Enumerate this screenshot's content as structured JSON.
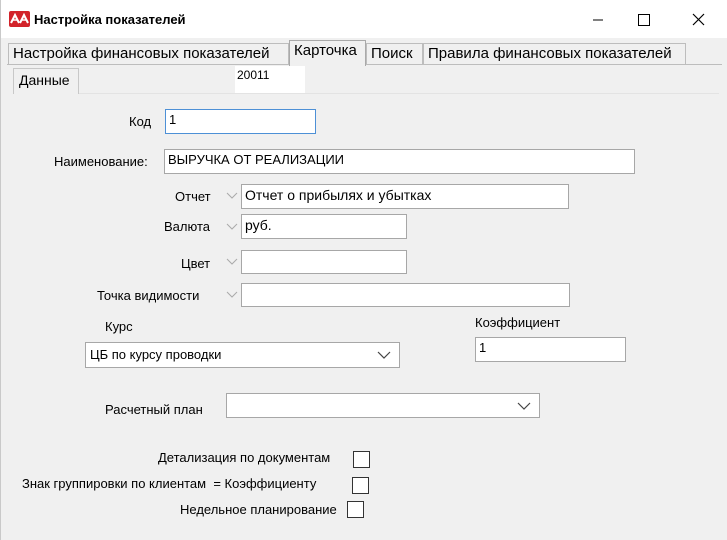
{
  "window": {
    "title": "Настройка показателей",
    "controls": [
      "minimize-icon",
      "maximize-icon",
      "close-icon"
    ],
    "brand_color": "#d2232a"
  },
  "tabs": [
    {
      "label": "Настройка финансовых показателей",
      "active": false
    },
    {
      "label": "Карточка",
      "active": true
    },
    {
      "label": "Поиск",
      "active": false
    },
    {
      "label": "Правила финансовых показателей",
      "active": false
    }
  ],
  "subtab": {
    "label": "Данные"
  },
  "record_code": "20011",
  "form": {
    "code": {
      "label": "Код",
      "value": "1"
    },
    "name": {
      "label": "Наименование:",
      "value": "ВЫРУЧКА ОТ РЕАЛИЗАЦИИ"
    },
    "report": {
      "label": "Отчет",
      "value": "Отчет о прибылях и убытках"
    },
    "currency": {
      "label": "Валюта",
      "value": "руб."
    },
    "color": {
      "label": "Цвет",
      "value": ""
    },
    "visibility_point": {
      "label": "Точка видимости",
      "value": ""
    },
    "rate": {
      "label": "Курс",
      "selected": "ЦБ по курсу проводки"
    },
    "coefficient": {
      "label": "Коэффициент",
      "value": "1"
    },
    "settlement_plan": {
      "label": "Расчетный план",
      "selected": ""
    },
    "checkboxes": [
      {
        "label": "Детализация по документам",
        "checked": false
      },
      {
        "label": "Знак группировки по клиентам  = Коэффициенту",
        "checked": false
      },
      {
        "label": "Недельное планирование",
        "checked": false
      }
    ]
  }
}
